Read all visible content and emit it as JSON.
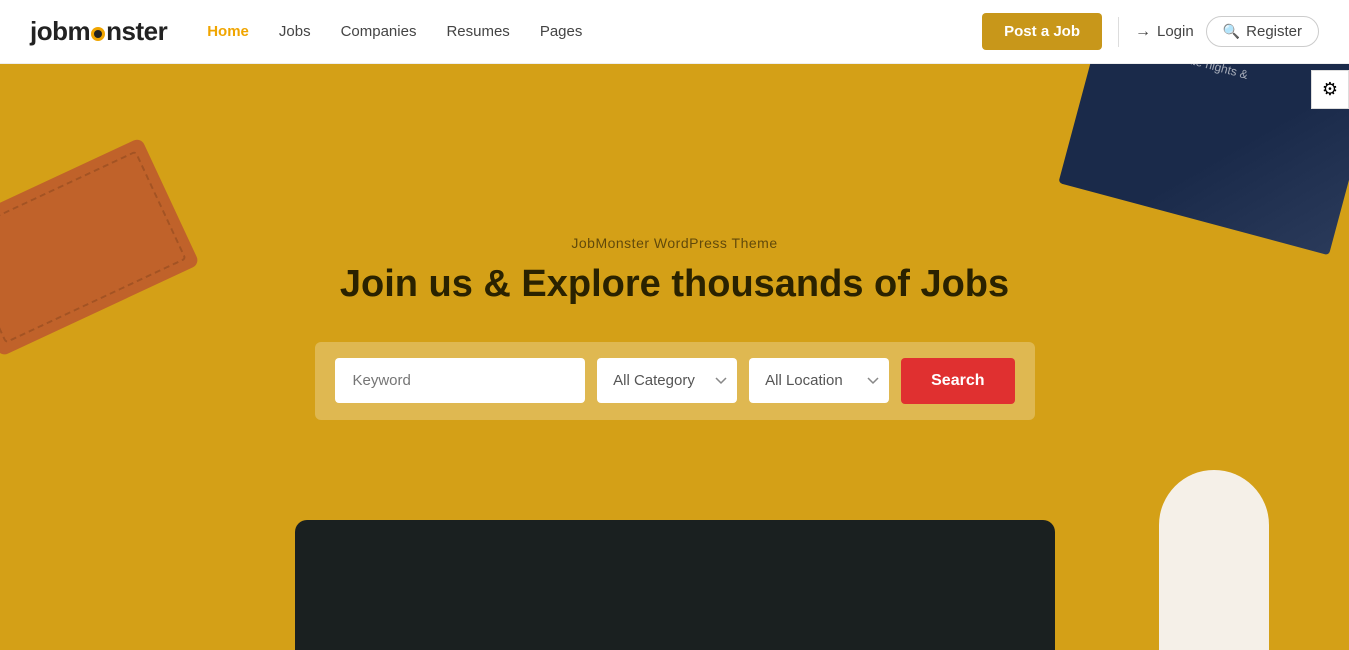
{
  "brand": {
    "name_start": "job",
    "name_end": "nster",
    "dot_char": "●"
  },
  "navbar": {
    "links": [
      {
        "label": "Home",
        "active": true
      },
      {
        "label": "Jobs",
        "active": false
      },
      {
        "label": "Companies",
        "active": false
      },
      {
        "label": "Resumes",
        "active": false
      },
      {
        "label": "Pages",
        "active": false
      }
    ],
    "post_job_label": "Post a Job",
    "login_label": "Login",
    "register_label": "Register"
  },
  "hero": {
    "subtitle": "JobMonster WordPress Theme",
    "title": "Join us & Explore thousands of Jobs",
    "search": {
      "keyword_placeholder": "Keyword",
      "category_label": "All Category",
      "location_label": "All Location",
      "button_label": "Search"
    }
  },
  "settings_icon": "⚙"
}
